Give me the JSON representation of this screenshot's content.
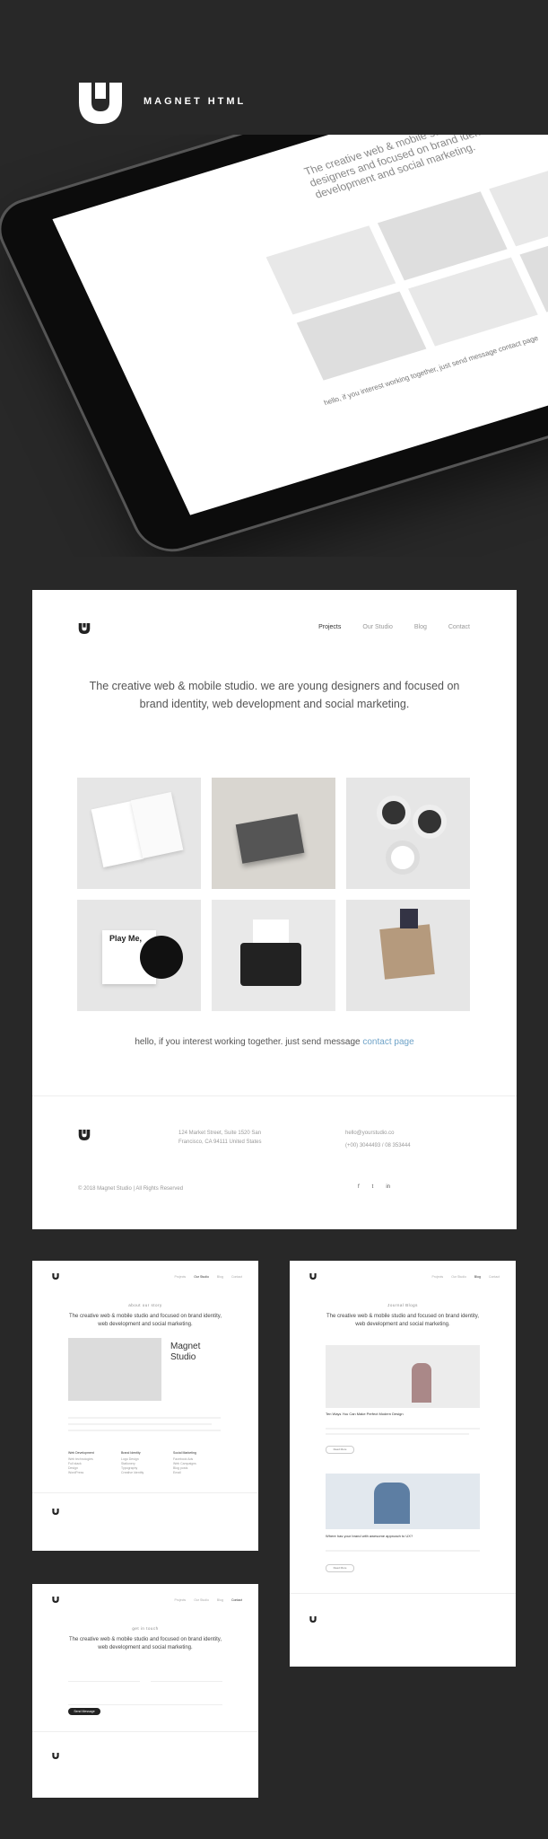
{
  "brand": {
    "name": "MAGNET HTML"
  },
  "tablet": {
    "hero": "The creative web & mobile studio, we are young designers and focused on brand identity, web development and social marketing.",
    "contact": "hello, if you interest working together, just send message contact page"
  },
  "main": {
    "nav": [
      "Projects",
      "Our Studio",
      "Blog",
      "Contact"
    ],
    "hero": "The creative web & mobile studio. we are young designers and focused on brand identity, web development and social marketing.",
    "contact_text": "hello, if you interest working together. just send message ",
    "contact_link": "contact page",
    "tiles": [
      {
        "label": "",
        "image": "business-cards"
      },
      {
        "label": "",
        "image": "grey-box-package"
      },
      {
        "label": "",
        "image": "sticker-tape-rolls"
      },
      {
        "label": "Play Me,",
        "image": "cd-cover"
      },
      {
        "label": "",
        "image": "typewriter"
      },
      {
        "label": "",
        "image": "paper-bag"
      }
    ],
    "footer": {
      "address": "124 Market Street, Suite 1520 San Francisco, CA 94111 United States",
      "email": "hello@yourstudio.co",
      "phone": "(+00) 3044493 / 08 353444",
      "copyright": "© 2018 Magnet Studio | All Rights Reserved",
      "social": [
        "f",
        "t",
        "in"
      ]
    }
  },
  "about": {
    "nav": [
      "Projects",
      "Our Studio",
      "Blog",
      "Contact"
    ],
    "label": "about our story",
    "hero": "The creative web & mobile studio and focused on brand identity, web development and social marketing.",
    "title_line1": "Magnet",
    "title_line2": "Studio",
    "services": [
      {
        "title": "Web Development",
        "items": [
          "Web technologies",
          "Full stack",
          "Design",
          "WordPress"
        ]
      },
      {
        "title": "Brand Identity",
        "items": [
          "Logo Design",
          "Stationery",
          "Typography",
          "Creative Identity"
        ]
      },
      {
        "title": "Social Marketing",
        "items": [
          "Facebook Ads",
          "Web Campaigns",
          "Blog posts",
          "Email"
        ]
      }
    ]
  },
  "blog": {
    "nav": [
      "Projects",
      "Our Studio",
      "Blog",
      "Contact"
    ],
    "label": "Journal Blogs",
    "hero": "The creative web & mobile studio and focused on brand identity, web development and social marketing.",
    "posts": [
      {
        "title": "Ten Ways You Can Make Perfect Modern Design"
      },
      {
        "title": "Where has your brand with awesome approach to UX?"
      }
    ],
    "read_more": "Read More"
  },
  "contact": {
    "nav": [
      "Projects",
      "Our Studio",
      "Blog",
      "Contact"
    ],
    "label": "get in touch",
    "hero": "The creative web & mobile studio and focused on brand identity, web development and social marketing.",
    "button": "Send Message"
  }
}
